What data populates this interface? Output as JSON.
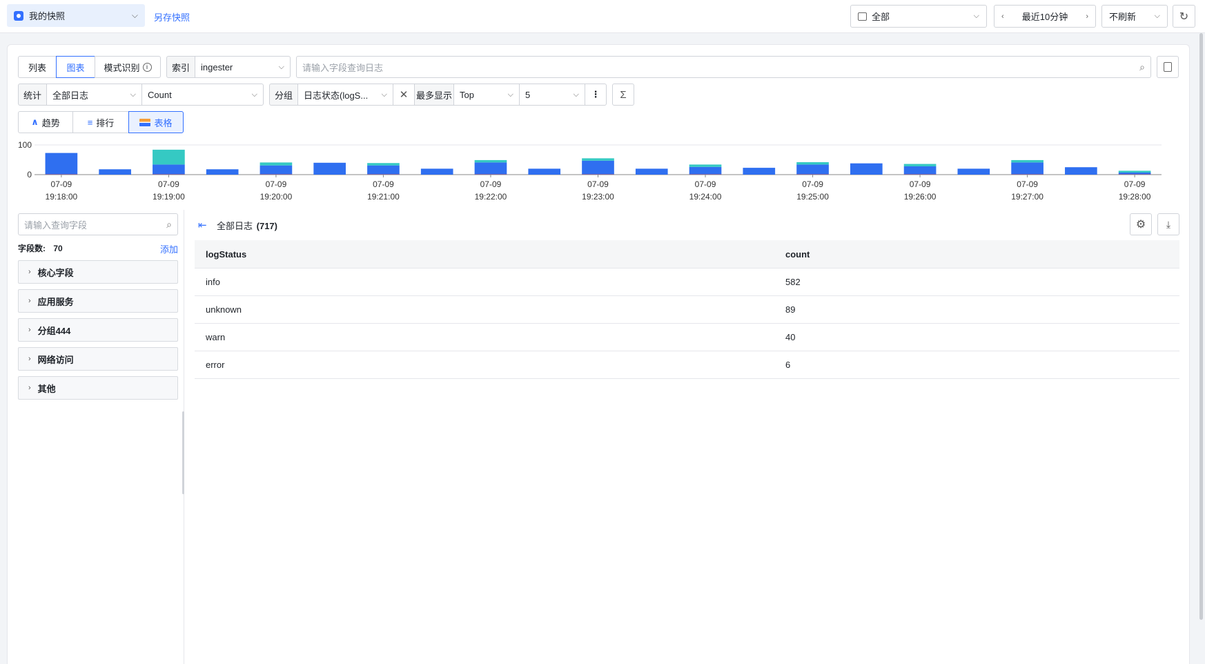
{
  "topbar": {
    "snapshot_label": "我的快照",
    "save_snapshot": "另存快照",
    "scope": "全部",
    "time_range": "最近10分钟",
    "refresh": "不刷新"
  },
  "mode_tabs": [
    "列表",
    "图表",
    "模式识别"
  ],
  "index": {
    "label": "索引",
    "value": "ingester"
  },
  "search": {
    "placeholder": "请输入字段查询日志"
  },
  "stats": {
    "label": "统计",
    "source": "全部日志",
    "metric": "Count",
    "group_label": "分组",
    "group_value": "日志状态(logS...",
    "max_label": "最多显示",
    "max_mode": "Top",
    "max_value": "5"
  },
  "view_tabs": [
    "趋势",
    "排行",
    "表格"
  ],
  "chart_data": {
    "type": "bar",
    "stacked": true,
    "categories": [
      "19:18:00",
      "",
      "19:19:00",
      "",
      "19:20:00",
      "",
      "19:21:00",
      "",
      "19:22:00",
      "",
      "19:23:00",
      "",
      "19:24:00",
      "",
      "19:25:00",
      "",
      "19:26:00",
      "",
      "19:27:00",
      "",
      "19:28:00"
    ],
    "x_tick_labels": [
      {
        "date": "07-09",
        "time": "19:18:00"
      },
      {
        "date": "07-09",
        "time": "19:19:00"
      },
      {
        "date": "07-09",
        "time": "19:20:00"
      },
      {
        "date": "07-09",
        "time": "19:21:00"
      },
      {
        "date": "07-09",
        "time": "19:22:00"
      },
      {
        "date": "07-09",
        "time": "19:23:00"
      },
      {
        "date": "07-09",
        "time": "19:24:00"
      },
      {
        "date": "07-09",
        "time": "19:25:00"
      },
      {
        "date": "07-09",
        "time": "19:26:00"
      },
      {
        "date": "07-09",
        "time": "19:27:00"
      },
      {
        "date": "07-09",
        "time": "19:28:00"
      }
    ],
    "y_ticks": [
      "100",
      "0"
    ],
    "ylim": [
      0,
      100
    ],
    "series": [
      {
        "color": "#2f6ff0",
        "values": [
          72,
          18,
          33,
          18,
          30,
          40,
          30,
          20,
          40,
          20,
          46,
          20,
          25,
          23,
          33,
          38,
          27,
          20,
          40,
          25,
          6
        ]
      },
      {
        "color": "#35c9c3",
        "values": [
          0,
          0,
          50,
          0,
          10,
          0,
          8,
          0,
          8,
          0,
          8,
          0,
          8,
          0,
          8,
          0,
          8,
          0,
          8,
          0,
          6
        ]
      },
      {
        "color": "#f5503c",
        "values": [
          1,
          0,
          1,
          0,
          1,
          0,
          1,
          0,
          1,
          0,
          1,
          0,
          1,
          0,
          1,
          0,
          1,
          0,
          1,
          0,
          1
        ]
      }
    ]
  },
  "sidebar": {
    "search_placeholder": "请输入查询字段",
    "field_count_label": "字段数:",
    "field_count": "70",
    "add_label": "添加",
    "groups": [
      "核心字段",
      "应用服务",
      "分组444",
      "网络访问",
      "其他"
    ]
  },
  "result": {
    "title": "全部日志",
    "count": "(717)",
    "columns": [
      "logStatus",
      "count"
    ],
    "rows": [
      [
        "info",
        "582"
      ],
      [
        "unknown",
        "89"
      ],
      [
        "warn",
        "40"
      ],
      [
        "error",
        "6"
      ]
    ]
  }
}
